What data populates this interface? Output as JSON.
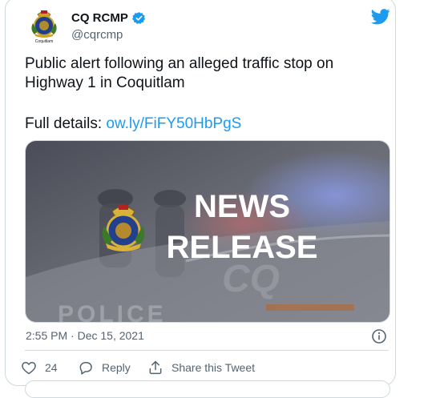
{
  "account": {
    "display_name": "CQ RCMP",
    "handle": "@cqrcmp",
    "avatar_caption": "Coquitlam",
    "verified": true
  },
  "tweet": {
    "text_line1": "Public alert following an alleged traffic stop on",
    "text_line2": "Highway 1 in Coquitlam",
    "details_label": "Full details:",
    "details_link": "ow.ly/FiFY50HbPgS"
  },
  "media": {
    "headline_line1": "NEWS",
    "headline_line2": "RELEASE",
    "vehicle_text": "POLICE"
  },
  "meta": {
    "timestamp": "2:55 PM · Dec 15, 2021"
  },
  "actions": {
    "like_count": "24",
    "reply_label": "Reply",
    "share_label": "Share this Tweet"
  },
  "colors": {
    "accent": "#1d9bf0",
    "text": "#0f1419",
    "muted": "#536471",
    "border": "#cfd9de"
  }
}
